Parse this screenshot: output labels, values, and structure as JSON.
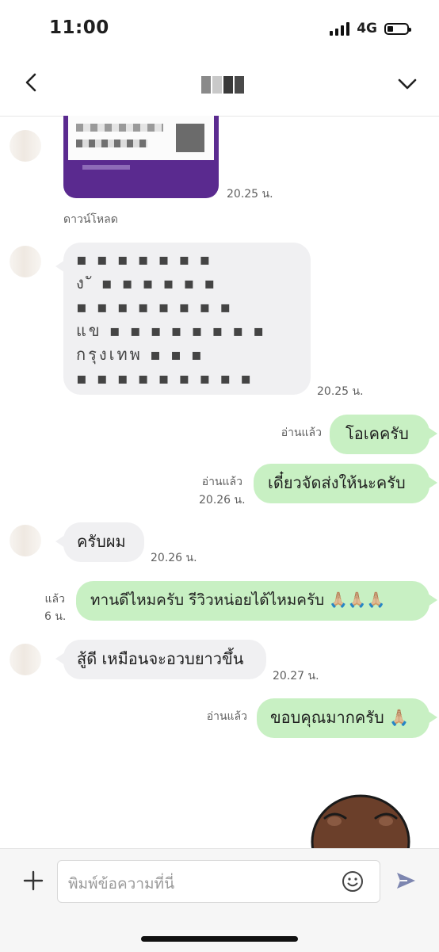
{
  "status_bar": {
    "time": "11:00",
    "network": "4G"
  },
  "header": {
    "contact_name": "▪▪▪"
  },
  "messages": [
    {
      "side": "in",
      "kind": "image",
      "time": "20.25 น.",
      "caption": "ดาวน์โหลด"
    },
    {
      "side": "in",
      "kind": "text",
      "lines": [
        "▪ ▪ ▪ ▪ ▪ ▪ ▪",
        "ง ั ▪ ▪ ▪ ▪ ▪ ▪",
        "▪ ▪ ▪ ▪ ▪ ▪ ▪ ▪",
        "แข ▪ ▪ ▪ ▪ ▪ ▪ ▪ ▪",
        "กรุงเทพ ▪ ▪ ▪",
        "▪ ▪ ▪ ▪ ▪ ▪ ▪ ▪ ▪"
      ],
      "time": "20.25 น."
    },
    {
      "side": "out",
      "text": "โอเคครับ",
      "read": "อ่านแล้ว"
    },
    {
      "side": "out",
      "text": "เดี๋ยวจัดส่งให้นะครับ",
      "read": "อ่านแล้ว",
      "time": "20.26 น."
    },
    {
      "side": "in",
      "text": "ครับผม",
      "time": "20.26 น."
    },
    {
      "side": "out",
      "text": "ทานดีไหมครับ รีวิวหน่อยได้ไหมครับ 🙏🏼🙏🏼🙏🏼",
      "read": "แล้ว",
      "time": "6 น."
    },
    {
      "side": "in",
      "text": "สู้ดี เหมือนจะอวบยาวขึ้น",
      "time": "20.27 น."
    },
    {
      "side": "out",
      "text": "ขอบคุณมากครับ 🙏🏼",
      "read": "อ่านแล้ว"
    }
  ],
  "composer": {
    "placeholder": "พิมพ์ข้อความที่นี่"
  },
  "colors": {
    "outgoing": "#c8f0c3",
    "incoming": "#f0f0f2",
    "image_frame": "#5a2a8f",
    "sticker": "#6b3f2a"
  },
  "icons": [
    "back-chevron-icon",
    "chevron-down-icon",
    "plus-icon",
    "smiley-icon",
    "send-icon",
    "signal-icon",
    "battery-icon"
  ]
}
